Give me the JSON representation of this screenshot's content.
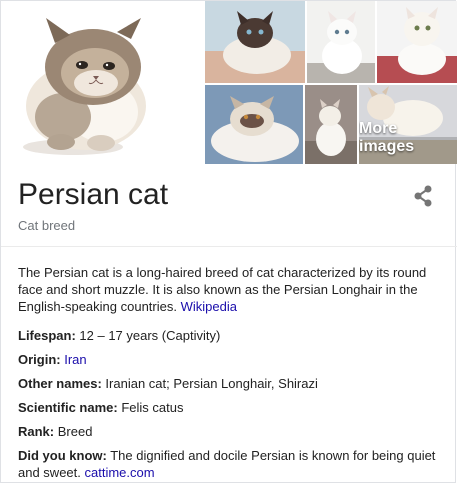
{
  "gallery": {
    "more_images_label": "More images",
    "tiles": [
      "main-image",
      "thumb-1",
      "thumb-2",
      "thumb-3",
      "thumb-4",
      "thumb-5",
      "thumb-6"
    ]
  },
  "header": {
    "title": "Persian cat",
    "subtitle": "Cat breed",
    "share_icon": "share-icon"
  },
  "description": {
    "text": "The Persian cat is a long-haired breed of cat characterized by its round face and short muzzle. It is also known as the Persian Longhair in the English-speaking countries. ",
    "source_link": "Wikipedia"
  },
  "facts": {
    "lifespan": {
      "label": "Lifespan:",
      "value": " 12 – 17 years (Captivity)"
    },
    "origin": {
      "label": "Origin:",
      "value": "Iran"
    },
    "other_names": {
      "label": "Other names:",
      "value": " Iranian cat; Persian Longhair, Shirazi"
    },
    "scientific_name": {
      "label": "Scientific name:",
      "value": " Felis catus"
    },
    "rank": {
      "label": "Rank:",
      "value": " Breed"
    },
    "did_you_know": {
      "label": "Did you know:",
      "value": " The dignified and docile Persian is known for being quiet and sweet. ",
      "source_link": "cattime.com"
    }
  },
  "colors": {
    "link": "#1a0dab",
    "muted": "#70757a",
    "text": "#222222",
    "divider": "#ebebeb"
  }
}
